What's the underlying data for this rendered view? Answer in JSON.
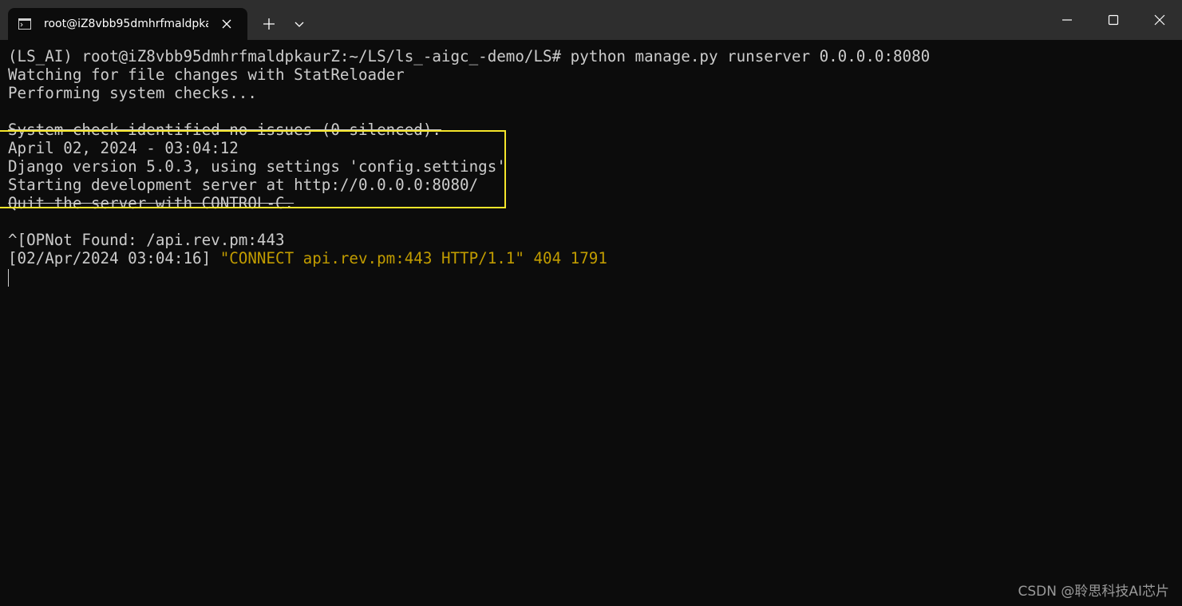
{
  "window": {
    "tab_title": "root@iZ8vbb95dmhrfmaldpkaurZ: ~/LS/ls_-aigc_-demo/LS",
    "tab_icon": "terminal-icon",
    "close_tab_icon": "close-icon",
    "new_tab_icon": "plus-icon",
    "dropdown_icon": "chevron-down-icon",
    "minimize_icon": "minimize-icon",
    "maximize_icon": "maximize-icon",
    "close_window_icon": "close-icon"
  },
  "terminal": {
    "lines": [
      "(LS_AI) root@iZ8vbb95dmhrfmaldpkaurZ:~/LS/ls_-aigc_-demo/LS# python manage.py runserver 0.0.0.0:8080",
      "Watching for file changes with StatReloader",
      "Performing system checks...",
      "",
      "System check identified no issues (0 silenced).",
      "April 02, 2024 - 03:04:12",
      "Django version 5.0.3, using settings 'config.settings'",
      "Starting development server at http://0.0.0.0:8080/",
      "Quit the server with CONTROL-C.",
      "",
      "^[OPNot Found: /api.rev.pm:443"
    ],
    "log_line": {
      "timestamp": "[02/Apr/2024 03:04:16] ",
      "request": "\"CONNECT api.rev.pm:443 HTTP/1.1\" 404 1791"
    },
    "colors": {
      "background": "#0c0c0c",
      "foreground": "#cccccc",
      "warning": "#c19c00",
      "highlight_border": "#f5e52a"
    }
  },
  "watermark": "CSDN @聆思科技AI芯片"
}
